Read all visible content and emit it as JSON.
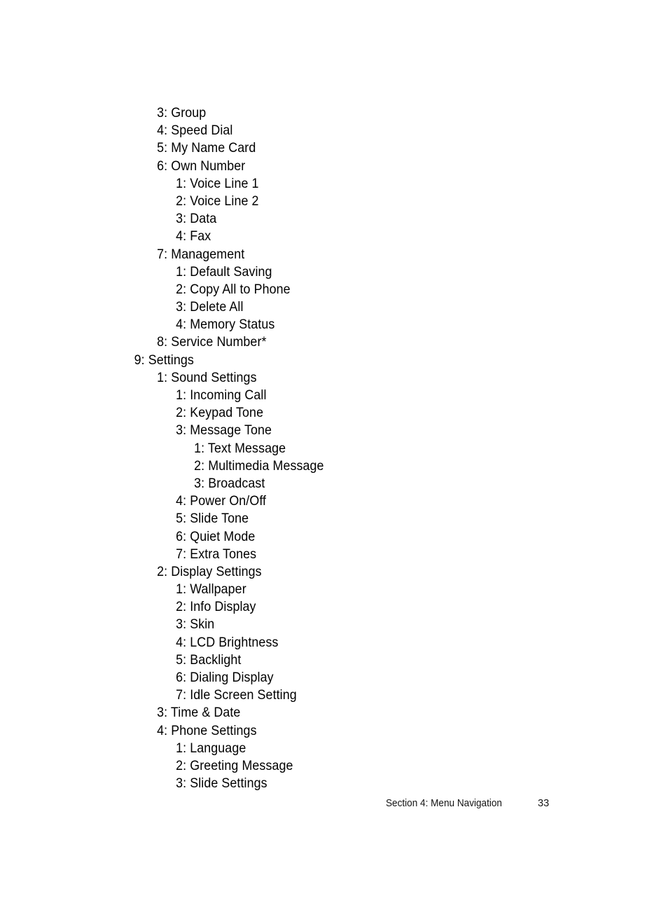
{
  "document": {
    "type": "printed-manual-page",
    "background_color": "#ffffff",
    "text_color": "#000000"
  },
  "menu_outline": [
    {
      "level": 2,
      "text": "3: Group"
    },
    {
      "level": 2,
      "text": "4: Speed Dial"
    },
    {
      "level": 2,
      "text": "5: My Name Card"
    },
    {
      "level": 2,
      "text": "6: Own Number"
    },
    {
      "level": 3,
      "text": "1: Voice Line 1"
    },
    {
      "level": 3,
      "text": "2: Voice Line 2"
    },
    {
      "level": 3,
      "text": "3: Data"
    },
    {
      "level": 3,
      "text": "4: Fax"
    },
    {
      "level": 2,
      "text": "7: Management"
    },
    {
      "level": 3,
      "text": "1: Default Saving"
    },
    {
      "level": 3,
      "text": "2: Copy All to Phone"
    },
    {
      "level": 3,
      "text": "3: Delete All"
    },
    {
      "level": 3,
      "text": "4: Memory Status"
    },
    {
      "level": 2,
      "text": "8: Service Number*"
    },
    {
      "level": 1,
      "text": "9: Settings"
    },
    {
      "level": 2,
      "text": "1: Sound Settings"
    },
    {
      "level": 3,
      "text": "1: Incoming Call"
    },
    {
      "level": 3,
      "text": "2: Keypad Tone"
    },
    {
      "level": 3,
      "text": "3: Message Tone"
    },
    {
      "level": 4,
      "text": "1: Text Message"
    },
    {
      "level": 4,
      "text": "2: Multimedia Message"
    },
    {
      "level": 4,
      "text": "3: Broadcast"
    },
    {
      "level": 3,
      "text": "4: Power On/Off"
    },
    {
      "level": 3,
      "text": "5: Slide Tone"
    },
    {
      "level": 3,
      "text": "6: Quiet Mode"
    },
    {
      "level": 3,
      "text": "7: Extra Tones"
    },
    {
      "level": 2,
      "text": "2: Display Settings"
    },
    {
      "level": 3,
      "text": "1: Wallpaper"
    },
    {
      "level": 3,
      "text": "2: Info Display"
    },
    {
      "level": 3,
      "text": "3: Skin"
    },
    {
      "level": 3,
      "text": "4: LCD Brightness"
    },
    {
      "level": 3,
      "text": "5: Backlight"
    },
    {
      "level": 3,
      "text": "6: Dialing Display"
    },
    {
      "level": 3,
      "text": "7: Idle Screen Setting"
    },
    {
      "level": 2,
      "text": "3: Time & Date"
    },
    {
      "level": 2,
      "text": "4: Phone Settings"
    },
    {
      "level": 3,
      "text": "1: Language"
    },
    {
      "level": 3,
      "text": "2: Greeting Message"
    },
    {
      "level": 3,
      "text": "3: Slide Settings"
    }
  ],
  "footer": {
    "section_label": "Section 4: Menu Navigation",
    "page_number": "33"
  }
}
